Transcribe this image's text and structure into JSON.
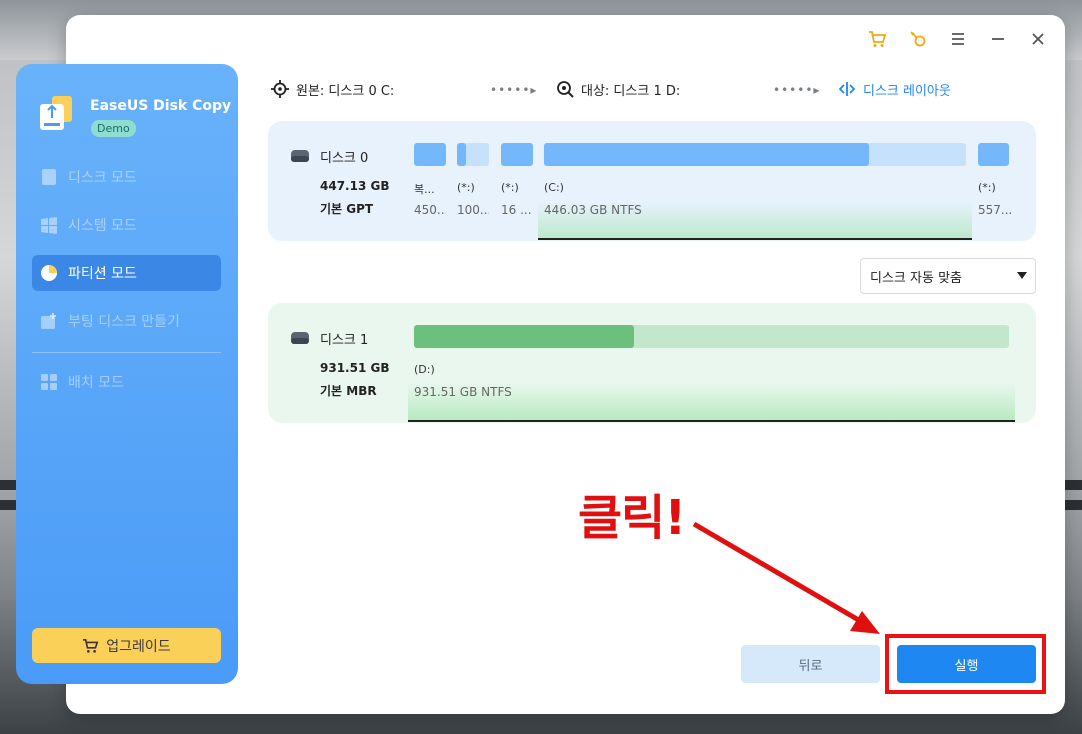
{
  "app": {
    "title": "EaseUS Disk Copy",
    "badge": "Demo"
  },
  "sidebar": {
    "items": [
      {
        "label": "디스크 모드",
        "state": "disabled"
      },
      {
        "label": "시스템 모드",
        "state": "disabled"
      },
      {
        "label": "파티션 모드",
        "state": "active"
      },
      {
        "label": "부팅 디스크 만들기",
        "state": "disabled"
      },
      {
        "label": "배치 모드",
        "state": "disabled"
      }
    ],
    "upgrade_label": "업그레이드"
  },
  "topbar": {
    "source_label": "원본: 디스크 0 C:",
    "target_label": "대상: 디스크 1 D:",
    "dots": "•••••▸",
    "layout_label": "디스크 레이아웃"
  },
  "disk0": {
    "name": "디스크 0",
    "size": "447.13 GB",
    "type": "기본 GPT",
    "partitions": [
      {
        "label": "복...",
        "info": "450..."
      },
      {
        "label": "(*:)",
        "info": "100..."
      },
      {
        "label": "(*:)",
        "info": "16 ..."
      },
      {
        "label": "(C:)",
        "info": "446.03 GB NTFS",
        "used_fraction": 0.77
      },
      {
        "label": "(*:)",
        "info": "557..."
      }
    ]
  },
  "disk1": {
    "name": "디스크 1",
    "size": "931.51 GB",
    "type": "기본 MBR",
    "partitions": [
      {
        "label": "(D:)",
        "info": "931.51 GB NTFS",
        "used_fraction": 0.37
      }
    ]
  },
  "fit_select": {
    "value": "디스크 자동 맞춤"
  },
  "buttons": {
    "back": "뒤로",
    "run": "실행"
  },
  "annotation": {
    "text": "클릭!",
    "color": "#ee1111"
  },
  "colors": {
    "accent": "#1f87f2",
    "sidebar": "#4a9bf7",
    "upgrade": "#fbd059",
    "disk0_bg": "#e8f2fd",
    "disk1_bg": "#e9f7ee"
  }
}
